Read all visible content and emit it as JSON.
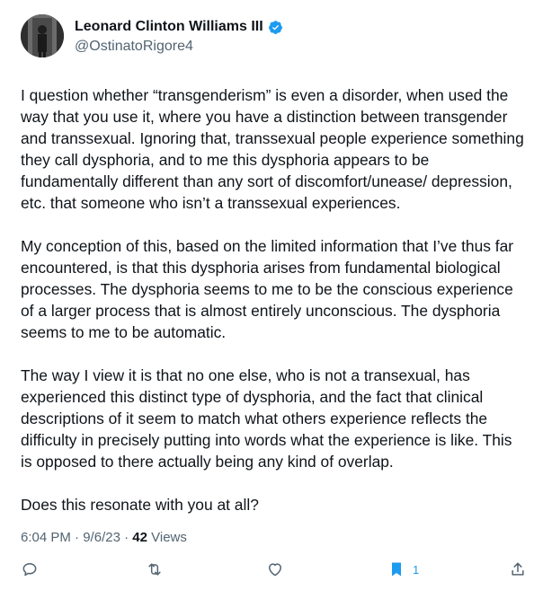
{
  "author": {
    "name": "Leonard Clinton Williams III",
    "handle": "@OstinatoRigore4",
    "verified_color": "#1d9bf0"
  },
  "tweet": {
    "paragraphs": [
      "I question whether “transgenderism” is even a disorder, when used the way that you use it, where you have a distinction between transgender and transsexual. Ignoring that, transsexual people experience something they call dysphoria, and to me this dysphoria appears to be fundamentally different than any sort of discomfort/unease/ depression, etc. that someone who isn’t a transsexual experiences.",
      "My conception of this, based on the limited information that I’ve thus far encountered, is that this dysphoria arises from fundamental biological processes. The dysphoria seems to me to be the conscious experience of a larger process that is almost entirely unconscious. The dysphoria seems to me to be automatic.",
      "The way I view it is that no one else, who is not a transexual, has experienced this distinct type of dysphoria, and the fact that clinical descriptions of it seem to match what others experience reflects the difficulty in precisely putting into words what the experience is like. This is opposed to there actually being any kind of overlap.",
      "Does this resonate with you at all?"
    ]
  },
  "meta": {
    "time": "6:04 PM",
    "sep1": " · ",
    "date": "9/6/23",
    "sep2": " · ",
    "views_count": "42",
    "views_label": " Views"
  },
  "actions": {
    "reply_icon": "reply-icon",
    "retweet_icon": "retweet-icon",
    "like_icon": "heart-icon",
    "bookmark_icon": "bookmark-icon",
    "bookmark_count": "1",
    "share_icon": "share-icon",
    "icon_color": "#536471",
    "active_color": "#1d9bf0"
  }
}
